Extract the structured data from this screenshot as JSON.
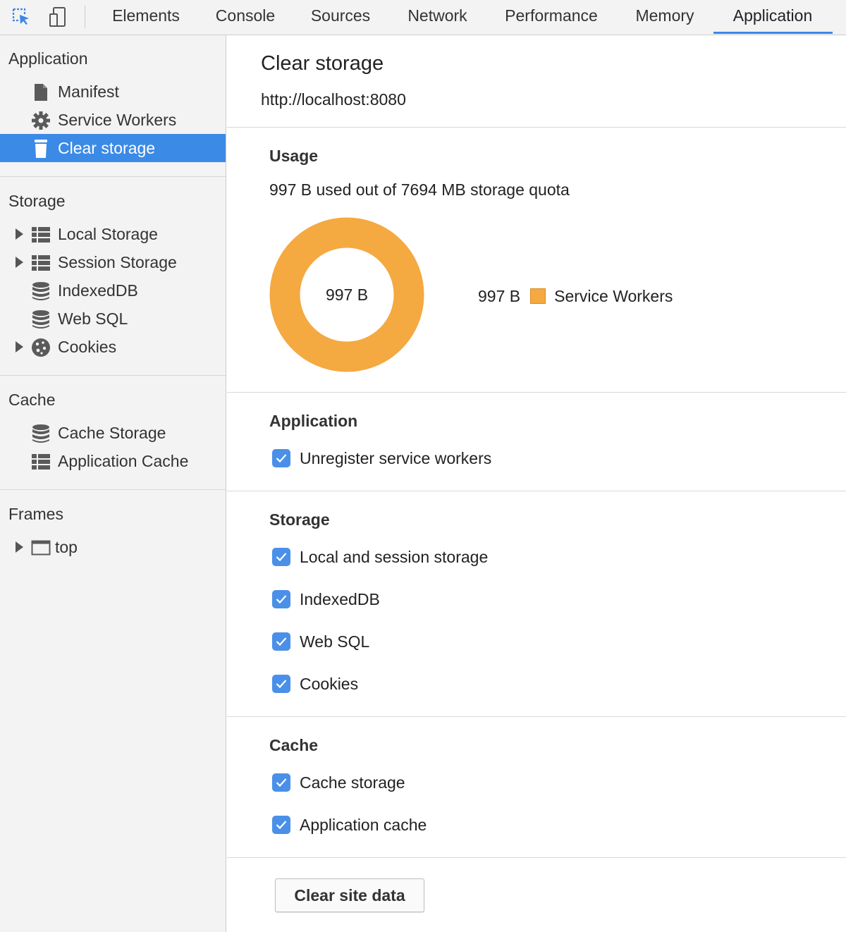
{
  "toolbar": {
    "tabs": [
      "Elements",
      "Console",
      "Sources",
      "Network",
      "Performance",
      "Memory",
      "Application"
    ],
    "active_tab": "Application"
  },
  "sidebar": {
    "application": {
      "header": "Application",
      "items": [
        {
          "label": "Manifest",
          "icon": "document-icon"
        },
        {
          "label": "Service Workers",
          "icon": "gear-icon"
        },
        {
          "label": "Clear storage",
          "icon": "trash-icon",
          "selected": true
        }
      ]
    },
    "storage": {
      "header": "Storage",
      "items": [
        {
          "label": "Local Storage",
          "icon": "grid-icon",
          "expandable": true
        },
        {
          "label": "Session Storage",
          "icon": "grid-icon",
          "expandable": true
        },
        {
          "label": "IndexedDB",
          "icon": "database-icon"
        },
        {
          "label": "Web SQL",
          "icon": "database-icon"
        },
        {
          "label": "Cookies",
          "icon": "cookie-icon",
          "expandable": true
        }
      ]
    },
    "cache": {
      "header": "Cache",
      "items": [
        {
          "label": "Cache Storage",
          "icon": "database-icon"
        },
        {
          "label": "Application Cache",
          "icon": "grid-icon"
        }
      ]
    },
    "frames": {
      "header": "Frames",
      "items": [
        {
          "label": "top",
          "icon": "frame-icon",
          "expandable": true
        }
      ]
    }
  },
  "main": {
    "title": "Clear storage",
    "origin": "http://localhost:8080",
    "usage": {
      "heading": "Usage",
      "summary": "997 B used out of 7694 MB storage quota",
      "donut_center": "997 B",
      "legend": [
        {
          "value": "997 B",
          "label": "Service Workers",
          "color": "#f4a941"
        }
      ]
    },
    "application_section": {
      "heading": "Application",
      "options": [
        {
          "label": "Unregister service workers",
          "checked": true
        }
      ]
    },
    "storage_section": {
      "heading": "Storage",
      "options": [
        {
          "label": "Local and session storage",
          "checked": true
        },
        {
          "label": "IndexedDB",
          "checked": true
        },
        {
          "label": "Web SQL",
          "checked": true
        },
        {
          "label": "Cookies",
          "checked": true
        }
      ]
    },
    "cache_section": {
      "heading": "Cache",
      "options": [
        {
          "label": "Cache storage",
          "checked": true
        },
        {
          "label": "Application cache",
          "checked": true
        }
      ]
    },
    "clear_button": "Clear site data"
  },
  "colors": {
    "accent": "#3b8ae6",
    "checkbox": "#4a90e8",
    "donut": "#f4a941"
  }
}
